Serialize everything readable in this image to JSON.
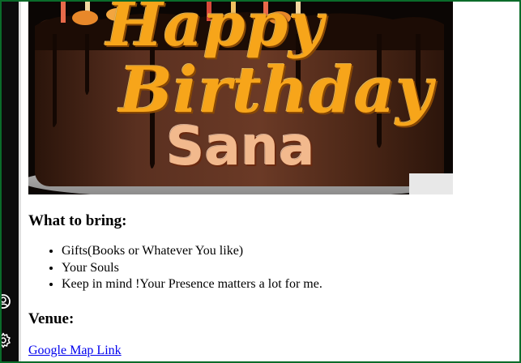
{
  "hero": {
    "greeting_line1": "Happy",
    "greeting_line2": "Birthday",
    "name": "Sana"
  },
  "bring": {
    "heading": "What to bring:",
    "items": [
      "Gifts(Books or Whatever You like)",
      "Your Souls",
      "Keep in mind !Your Presence matters a lot for me."
    ]
  },
  "venue": {
    "heading": "Venue:",
    "link_label": "Google Map Link"
  },
  "sidebar": {
    "icons": [
      "account-icon",
      "settings-gear-icon"
    ]
  },
  "colors": {
    "frame_border": "#0a6b2a",
    "link": "#0000ee",
    "cake_chocolate": "#4a2616",
    "greeting_gold": "#f7a51a",
    "name_peach": "#f2b98d"
  }
}
